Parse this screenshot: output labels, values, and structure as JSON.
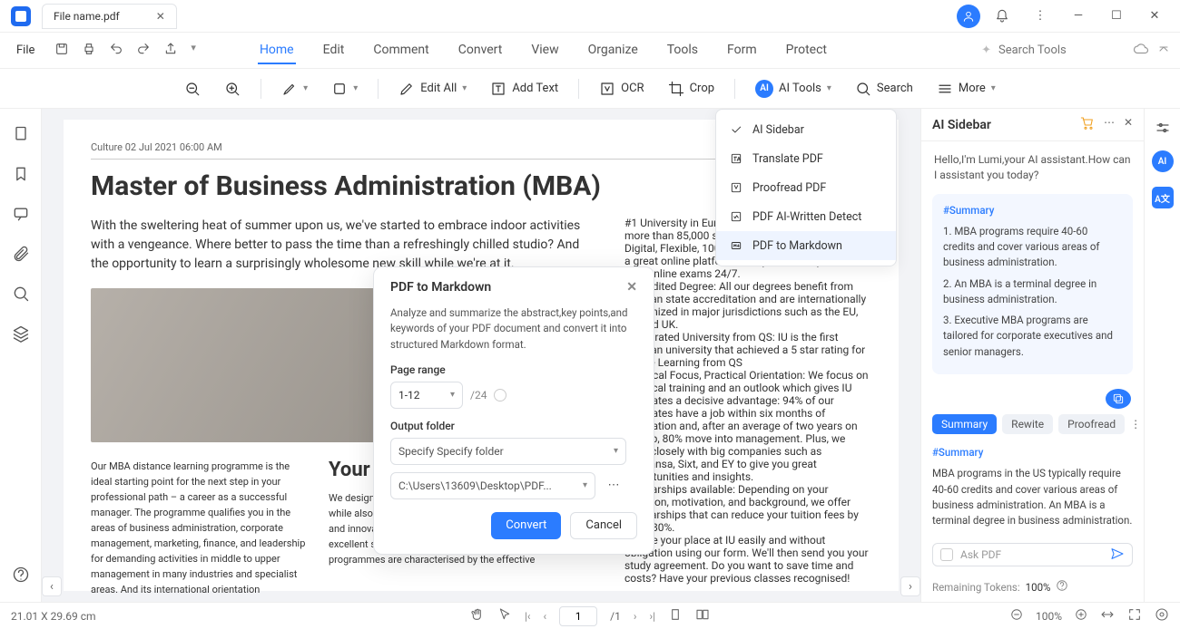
{
  "window": {
    "tab_title": "File name.pdf"
  },
  "menubar": {
    "file": "File",
    "tabs": [
      "Home",
      "Edit",
      "Comment",
      "Convert",
      "View",
      "Organize",
      "Tools",
      "Form",
      "Protect"
    ],
    "active_tab": "Home",
    "search_placeholder": "Search Tools"
  },
  "toolbar": {
    "edit_all": "Edit All",
    "add_text": "Add Text",
    "ocr": "OCR",
    "crop": "Crop",
    "ai_tools": "AI Tools",
    "search": "Search",
    "more": "More"
  },
  "ai_menu": {
    "items": [
      {
        "icon": "check",
        "label": "AI Sidebar"
      },
      {
        "icon": "translate",
        "label": "Translate PDF"
      },
      {
        "icon": "proofread",
        "label": "Proofread PDF"
      },
      {
        "icon": "detect",
        "label": "PDF AI-Written Detect"
      },
      {
        "icon": "markdown",
        "label": "PDF to Markdown"
      }
    ],
    "selected_index": 4
  },
  "modal": {
    "title": "PDF to Markdown",
    "desc": "Analyze and summarize the abstract,key points,and keywords of your PDF document and convert it into structured Markdown format.",
    "page_range_label": "Page range",
    "page_range_value": "1-12",
    "page_total": "/24",
    "output_folder_label": "Output folder",
    "specify_value": "Specify Specify folder",
    "path_value": "C:\\Users\\13609\\Desktop\\PDF...",
    "convert": "Convert",
    "cancel": "Cancel"
  },
  "sidebar": {
    "title": "AI Sidebar",
    "greeting": "Hello,I'm Lumi,your AI assistant.How can I assistant you today?",
    "summary_hash": "#Summary",
    "summary_points": [
      "1. MBA programs require 40-60 credits and cover various areas of business administration.",
      "2. An MBA is a terminal degree in business administration.",
      "3. Executive MBA programs are tailored for corporate executives and senior managers."
    ],
    "pills": [
      "Summary",
      "Rewite",
      "Proofread"
    ],
    "active_pill": 0,
    "card2_hash": "#Summary",
    "card2_body": "MBA programs in the US typically require 40-60 credits and cover various areas of business administration. An MBA is a terminal degree in business administration.",
    "ask_placeholder": "Ask PDF",
    "tokens_label": "Remaining Tokens:",
    "tokens_value": "100%"
  },
  "document": {
    "meta": "Culture 02 Jul 2021 06:00 AM",
    "h1": "Master of Business Administration (MBA)",
    "intro": "With the sweltering heat of summer upon us, we've started to embrace indoor activities with a vengeance. Where better to pass the time than a refreshingly chilled studio? And the opportunity to learn a surprisingly wholesome new skill while we're at it.",
    "col1": "Our MBA distance learning programme is the ideal starting point for the next step in your professional path – a career as a successful manager. The programme qualifies you in the areas of business administration, corporate management, marketing, finance, and leadership for demanding activities in middle to upper management in many industries and specialist areas. And its international orientation",
    "h2": "Your de",
    "col2": "We design our programmes to be flexible and innovative, while also maintaining quality. We deliver specialist expertise and innovative learning materials as well as focusing on excellent student services and professional advice. Our programmes are characterised by the effective",
    "col3": [
      "#1 University in Europe: Join a community with more than 85,000 students",
      "Digital, Flexible, 100% online learning materials and a great online platform. Study wherever you are with online exams 24/7.",
      "Accredited Degree: All our degrees benefit from German state accreditation and are internationally recognized in major jurisdictions such as the EU, US and UK.",
      "5 star rated University from QS: IU is the first German university that achieved a 5 star rating for Online Learning from QS",
      "Practical Focus, Practical Orientation: We focus on practical training and an outlook which gives IU graduates a decisive advantage: 94% of our graduates have a job within six months of graduation and, after an average of two years on the job, 80% move into management. Plus, we work closely with big companies such as Lufthansa, Sixt, and EY to give you great opportunities and insights.",
      "Scholarships available: Depending on your situation, motivation, and background, we offer scholarships that can reduce your tuition fees by up to 80%.",
      "Secure your place at IU easily and without obligation using our form. We'll then send you your study agreement. Do you want to save time and costs? Have your previous classes recognised!"
    ]
  },
  "statusbar": {
    "dims": "21.01 X 29.69 cm",
    "page_current": "1",
    "page_total": "/1",
    "zoom": "100%"
  }
}
